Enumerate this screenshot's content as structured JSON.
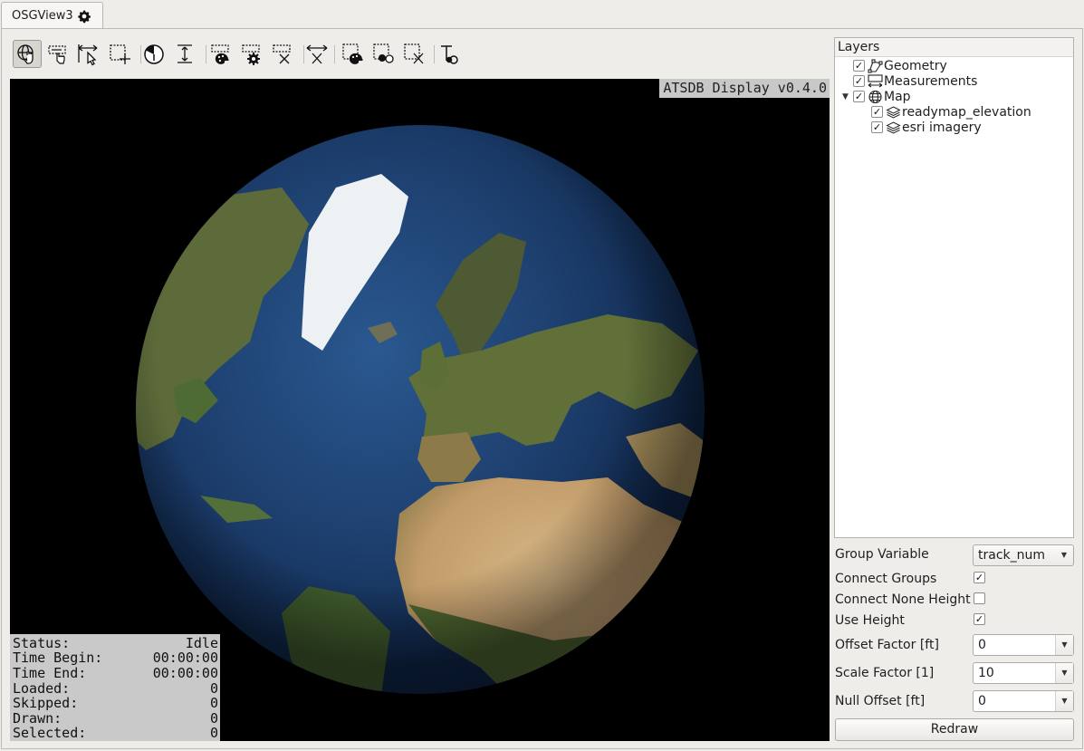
{
  "tab": {
    "title": "OSGView3",
    "icon": "gear-icon"
  },
  "toolbar": {
    "buttons": [
      {
        "name": "navigate-globe-tool",
        "icon": "globe-hand-icon",
        "active": true
      },
      {
        "name": "label-tool",
        "icon": "label-hand-icon"
      },
      {
        "name": "measure-tool",
        "icon": "measure-arrow-icon"
      },
      {
        "name": "select-rect-add-tool",
        "icon": "select-add-icon"
      },
      {
        "name": "time-filter-tool",
        "icon": "clock-icon"
      },
      {
        "name": "height-tool",
        "icon": "height-icon"
      },
      {
        "name": "label-color-tool",
        "icon": "label-palette-icon"
      },
      {
        "name": "label-settings-tool",
        "icon": "label-gear-icon"
      },
      {
        "name": "label-clear-tool",
        "icon": "label-clear-icon"
      },
      {
        "name": "measure-clear-tool",
        "icon": "measure-clear-icon"
      },
      {
        "name": "select-color-tool",
        "icon": "select-palette-icon"
      },
      {
        "name": "select-style-tool",
        "icon": "select-style-icon"
      },
      {
        "name": "select-clear-tool",
        "icon": "select-clear-icon"
      },
      {
        "name": "text-style-tool",
        "icon": "text-style-icon"
      }
    ]
  },
  "viewport": {
    "version_label": "ATSDB Display v0.4.0",
    "status": [
      {
        "label": "Status:",
        "value": "Idle"
      },
      {
        "label": "Time Begin:",
        "value": "00:00:00"
      },
      {
        "label": "Time End:",
        "value": "00:00:00"
      },
      {
        "label": "Loaded:",
        "value": "0"
      },
      {
        "label": "Skipped:",
        "value": "0"
      },
      {
        "label": "Drawn:",
        "value": "0"
      },
      {
        "label": "Selected:",
        "value": "0"
      }
    ]
  },
  "layers": {
    "title": "Layers",
    "items": [
      {
        "label": "Geometry",
        "checked": true,
        "icon": "geometry-icon",
        "depth": 0
      },
      {
        "label": "Measurements",
        "checked": true,
        "icon": "measure-icon",
        "depth": 0
      },
      {
        "label": "Map",
        "checked": true,
        "icon": "globe-icon",
        "depth": 0,
        "expanded": true
      },
      {
        "label": "readymap_elevation",
        "checked": true,
        "icon": "layers-icon",
        "depth": 1
      },
      {
        "label": "esri imagery",
        "checked": true,
        "icon": "layers-icon",
        "depth": 1
      }
    ]
  },
  "settings": {
    "group_variable": {
      "label": "Group Variable",
      "value": "track_num"
    },
    "connect_groups": {
      "label": "Connect Groups",
      "checked": true
    },
    "connect_none_height": {
      "label": "Connect None Height",
      "checked": false
    },
    "use_height": {
      "label": "Use Height",
      "checked": true
    },
    "offset_factor": {
      "label": "Offset Factor [ft]",
      "value": "0"
    },
    "scale_factor": {
      "label": "Scale Factor [1]",
      "value": "10"
    },
    "null_offset": {
      "label": "Null Offset [ft]",
      "value": "0"
    },
    "redraw_label": "Redraw"
  },
  "check_mark": "✓",
  "colors": {
    "ocean": "#1d3f6e",
    "land": "#6b6a3a",
    "desert": "#c4a070",
    "ice": "#f2f4f6"
  }
}
